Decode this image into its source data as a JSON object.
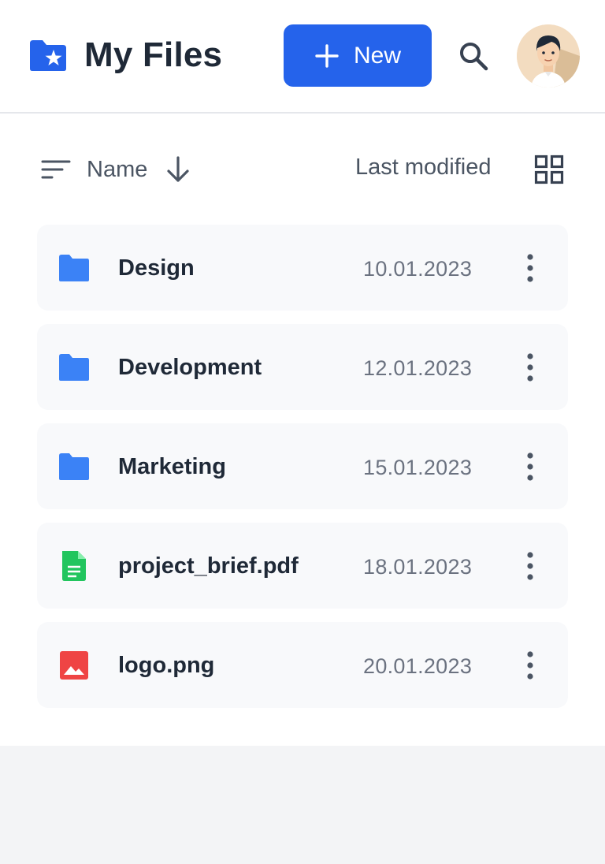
{
  "header": {
    "title": "My Files",
    "brand_icon": "folder-star-icon",
    "new_button_label": "New",
    "search_icon": "search-icon",
    "avatar_icon": "user-avatar"
  },
  "toolbar": {
    "sort_label": "Name",
    "sort_direction_icon": "arrow-down-icon",
    "modified_label": "Last modified",
    "view_icon": "grid-view-icon"
  },
  "files": [
    {
      "name": "Design",
      "date": "10.01.2023",
      "type": "folder"
    },
    {
      "name": "Development",
      "date": "12.01.2023",
      "type": "folder"
    },
    {
      "name": "Marketing",
      "date": "15.01.2023",
      "type": "folder"
    },
    {
      "name": "project_brief.pdf",
      "date": "18.01.2023",
      "type": "document"
    },
    {
      "name": "logo.png",
      "date": "20.01.2023",
      "type": "image"
    }
  ],
  "colors": {
    "accent": "#2563eb",
    "folder": "#3b82f6",
    "document": "#22c55e",
    "image": "#ef4444",
    "row_bg": "#f8f9fb",
    "page_bg": "#f3f4f6"
  }
}
